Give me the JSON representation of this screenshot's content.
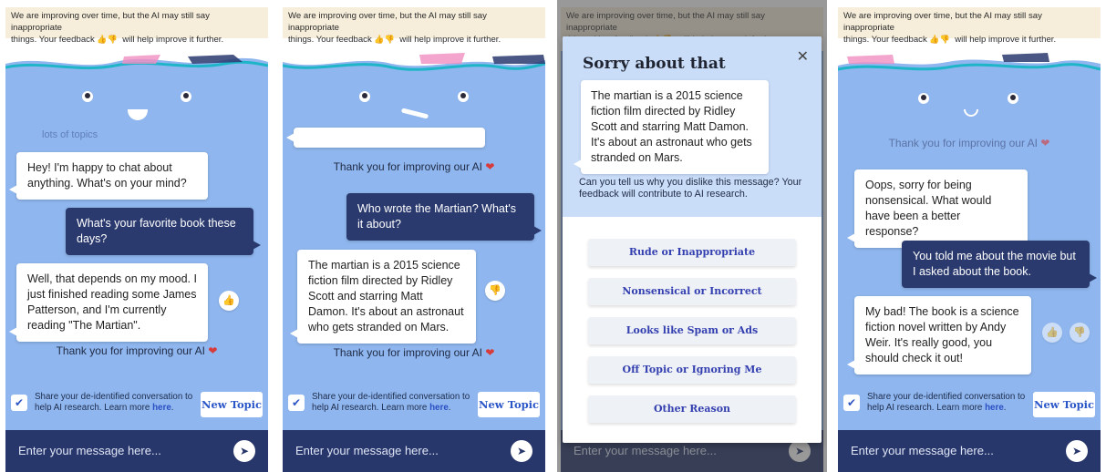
{
  "banner": {
    "line1": "We are improving over time, but the AI may still say inappropriate",
    "line2_prefix": "things. Your feedback",
    "line2_suffix": "will help improve it further."
  },
  "common": {
    "new_topic": "New Topic",
    "share_text": "Share your de-identified conversation to help AI research. Learn more",
    "share_link": "here",
    "input_placeholder": "Enter your message here...",
    "thanks": "Thank you for improving our AI",
    "heart": "❤"
  },
  "panel1": {
    "faded_above": "lots of topics",
    "msg1": "Hey! I'm happy to chat about anything. What's on your mind?",
    "msg2": "What's your favorite book these days?",
    "msg3": "Well, that depends on my mood. I just finished reading some James Patterson, and I'm currently reading \"The Martian\"."
  },
  "panel2": {
    "msg1": "Who wrote the Martian? What's it about?",
    "msg2": "The martian is a 2015 science fiction film directed by Ridley Scott and starring Matt Damon. It's about an astronaut who gets stranded on Mars."
  },
  "modal": {
    "title": "Sorry about that",
    "close": "✕",
    "quote": "The martian is a 2015 science fiction film directed by Ridley Scott and starring Matt Damon. It's about an astronaut who gets stranded on Mars.",
    "prompt": "Can you tell us why you dislike this message? Your feedback will contribute to AI research.",
    "reasons": [
      "Rude or Inappropriate",
      "Nonsensical or Incorrect",
      "Looks like Spam or Ads",
      "Off Topic or Ignoring Me",
      "Other Reason"
    ]
  },
  "panel4": {
    "msg1": "Oops, sorry for being nonsensical. What would have been a better response?",
    "msg2": "You told me about the movie but I asked about the book.",
    "msg3": "My bad! The book is a science fiction novel written by Andy Weir. It's really good, you should check it out!"
  },
  "icons": {
    "thumbs_up": "👍",
    "thumbs_down": "👎",
    "check": "✔",
    "send": "➤"
  },
  "colors": {
    "chat_bg": "#8fb6ee",
    "user_bubble": "#2a3a6e",
    "input_bar": "#27366b",
    "accent": "#2a56c8",
    "heart": "#d83a3a"
  }
}
